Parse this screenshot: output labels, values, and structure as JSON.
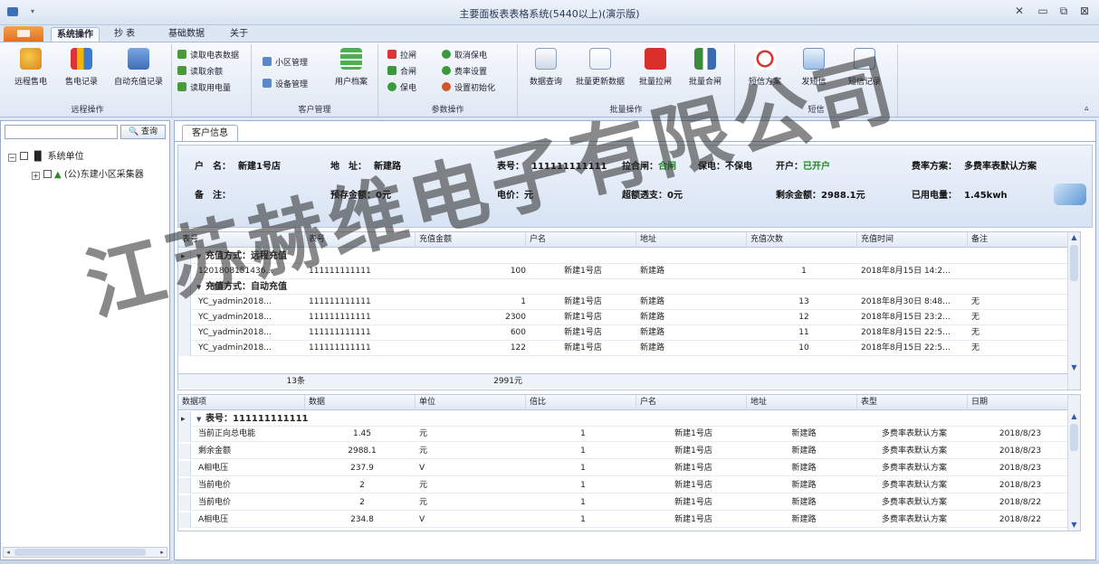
{
  "window": {
    "title": "主要面板表表格系统(5440以上)(演示版)"
  },
  "menu": {
    "tabs": [
      "系统操作",
      "抄 表",
      "基础数据",
      "关于"
    ]
  },
  "ribbon": {
    "groups": [
      {
        "label": "远程操作",
        "buttons": [
          "远程售电",
          "售电记录",
          "自动充值记录"
        ]
      },
      {
        "label": "",
        "small": [
          "读取电表数据",
          "读取余额",
          "读取用电量"
        ]
      },
      {
        "label": "客户管理",
        "buttons": [
          "小区管理",
          "用户档案"
        ],
        "small": [
          "小区管理",
          "设备管理"
        ]
      },
      {
        "label": "参数操作",
        "small": [
          "拉闸",
          "合闸",
          "保电",
          "取消保电",
          "费率设置",
          "设置初始化"
        ]
      },
      {
        "label": "批量操作",
        "buttons": [
          "数据查询",
          "批量更新数据",
          "批量拉闸",
          "批量合闸"
        ]
      },
      {
        "label": "短信",
        "buttons": [
          "短信方案",
          "发短信",
          "短信记录"
        ]
      }
    ]
  },
  "left": {
    "search_placeholder": "",
    "query_label": "查询",
    "tree": [
      {
        "label": "系统单位",
        "level": 0
      },
      {
        "label": "(公)东建小区采集器",
        "level": 1
      }
    ]
  },
  "main": {
    "tab": "客户信息",
    "info": {
      "user_label": "户　名：",
      "user_value": "新建1号店",
      "addr_label": "地　址：",
      "addr_value": "新建路",
      "meter_label": "表号：",
      "meter_value": "111111111111",
      "gate_label": "拉合闸：",
      "gate_value": "合闸",
      "keep_label": "保电：",
      "keep_value": "不保电",
      "open_label": "开户：",
      "open_value": "已开户",
      "scheme_label": "费率方案：",
      "scheme_value": "多费率表默认方案",
      "remark_label": "备　注：",
      "remark_value": "",
      "prepay_label": "预存金额：",
      "prepay_value": "0元",
      "price_label": "电价：",
      "price_value": "元",
      "arrears_label": "超额透支：",
      "arrears_value": "0元",
      "balance_label": "剩余金额：",
      "balance_value": "2988.1元",
      "used_label": "已用电量：",
      "used_value": "1.45kwh"
    },
    "grid1": {
      "headers": [
        "表号",
        "表号",
        "充值金额",
        "户名",
        "地址",
        "充值次数",
        "充值时间",
        "备注"
      ],
      "groups": [
        {
          "label": "充值方式：远程充值",
          "rows": [
            [
              "1201808151436...",
              "111111111111",
              "100",
              "新建1号店",
              "新建路",
              "1",
              "2018年8月15日 14:2...",
              ""
            ]
          ]
        },
        {
          "label": "充值方式：自动充值",
          "rows": [
            [
              "YC_yadmin2018...",
              "111111111111",
              "1",
              "新建1号店",
              "新建路",
              "13",
              "2018年8月30日 8:48...",
              "无"
            ],
            [
              "YC_yadmin2018...",
              "111111111111",
              "2300",
              "新建1号店",
              "新建路",
              "12",
              "2018年8月15日 23:2...",
              "无"
            ],
            [
              "YC_yadmin2018...",
              "111111111111",
              "600",
              "新建1号店",
              "新建路",
              "11",
              "2018年8月15日 22:5...",
              "无"
            ],
            [
              "YC_yadmin2018...",
              "111111111111",
              "122",
              "新建1号店",
              "新建路",
              "10",
              "2018年8月15日 22:5...",
              "无"
            ]
          ]
        }
      ],
      "footer_count": "13条",
      "footer_sum": "2991元"
    },
    "grid2": {
      "headers": [
        "数据项",
        "数据",
        "单位",
        "倍比",
        "户名",
        "地址",
        "表型",
        "日期"
      ],
      "group": "表号：111111111111",
      "rows": [
        [
          "当前正向总电能",
          "1.45",
          "元",
          "1",
          "新建1号店",
          "新建路",
          "多费率表默认方案",
          "2018/8/23"
        ],
        [
          "剩余金额",
          "2988.1",
          "元",
          "1",
          "新建1号店",
          "新建路",
          "多费率表默认方案",
          "2018/8/23"
        ],
        [
          "A相电压",
          "237.9",
          "V",
          "1",
          "新建1号店",
          "新建路",
          "多费率表默认方案",
          "2018/8/23"
        ],
        [
          "当前电价",
          "2",
          "元",
          "1",
          "新建1号店",
          "新建路",
          "多费率表默认方案",
          "2018/8/23"
        ],
        [
          "当前电价",
          "2",
          "元",
          "1",
          "新建1号店",
          "新建路",
          "多费率表默认方案",
          "2018/8/22"
        ],
        [
          "A相电压",
          "234.8",
          "V",
          "1",
          "新建1号店",
          "新建路",
          "多费率表默认方案",
          "2018/8/22"
        ]
      ]
    }
  },
  "watermark": "江苏赫维电子有限公司",
  "colors": {
    "accent": "#e2701d",
    "green": "#1a8a1a"
  }
}
